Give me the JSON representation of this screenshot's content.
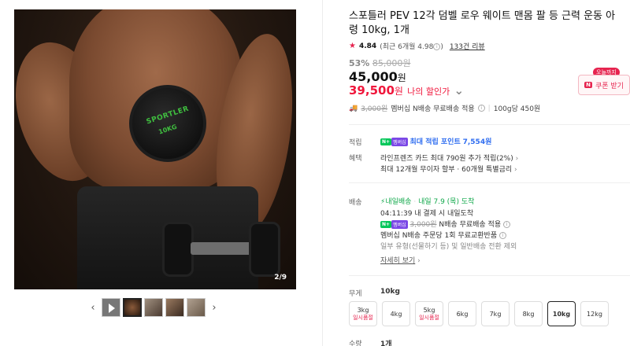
{
  "gallery": {
    "main_image_alt": "SPORTLER dumbbell",
    "dumbbell_brand": "SPORTLER",
    "dumbbell_weight": "10KG",
    "counter": "2/9",
    "prev_arrow": "‹",
    "next_arrow": "›"
  },
  "product": {
    "title": "스포틀러 PEV 12각 덤벨 로우 웨이트 맨몸 팔 등 근력 운동 아령 10kg, 1개",
    "rating": "4.84",
    "rating_detail": "(최근 6개월 4.98",
    "review_link": "133건 리뷰",
    "discount_pct": "53%",
    "original_price": "85,000원",
    "price": "45,000",
    "price_unit": "원",
    "my_price": "39,500",
    "my_price_unit": "원",
    "my_price_label": "나의 할인가",
    "coupon_tag": "오늘까지",
    "coupon_button": "쿠폰 받기",
    "coupon_n": "N",
    "shipping_strike": "3,000원",
    "shipping_text": "멤버십 N배송 무료배송 적용",
    "unit_price": "100g당 450원"
  },
  "points": {
    "label": "적립",
    "text": "최대 적립 포인트",
    "value": "7,554원"
  },
  "benefits": {
    "label": "혜택",
    "line1": "라인프렌즈 카드 최대 790원 추가 적립(2%)",
    "line2": "최대 12개월 무이자 할부 · 60개월 특별금리"
  },
  "delivery": {
    "label": "배송",
    "badge": "내일배송",
    "arrival": "내일 7.9 (목) 도착",
    "cutoff": "04:11:39  내 결제 시 내일도착",
    "n_strike": "3,000원",
    "n_text": "N배송 무료배송 적용",
    "exchange": "멤버십 N배송 주문당 1회 무료교환반품",
    "note": "일부 유형(선물하기 등) 및 일반배송 전환 제외",
    "detail": "자세히 보기"
  },
  "options": {
    "weight_label": "무게",
    "weight_value": "10kg",
    "qty_label": "수량",
    "qty_value": "1개",
    "items": [
      {
        "label": "3kg",
        "status": "일시품절"
      },
      {
        "label": "4kg",
        "status": ""
      },
      {
        "label": "5kg",
        "status": "일시품절"
      },
      {
        "label": "6kg",
        "status": ""
      },
      {
        "label": "7kg",
        "status": ""
      },
      {
        "label": "8kg",
        "status": ""
      },
      {
        "label": "10kg",
        "status": ""
      },
      {
        "label": "12kg",
        "status": ""
      }
    ]
  },
  "colors": {
    "accent_red": "#f0173c",
    "npay_green": "#03c75a",
    "link_blue": "#2f6df0"
  }
}
